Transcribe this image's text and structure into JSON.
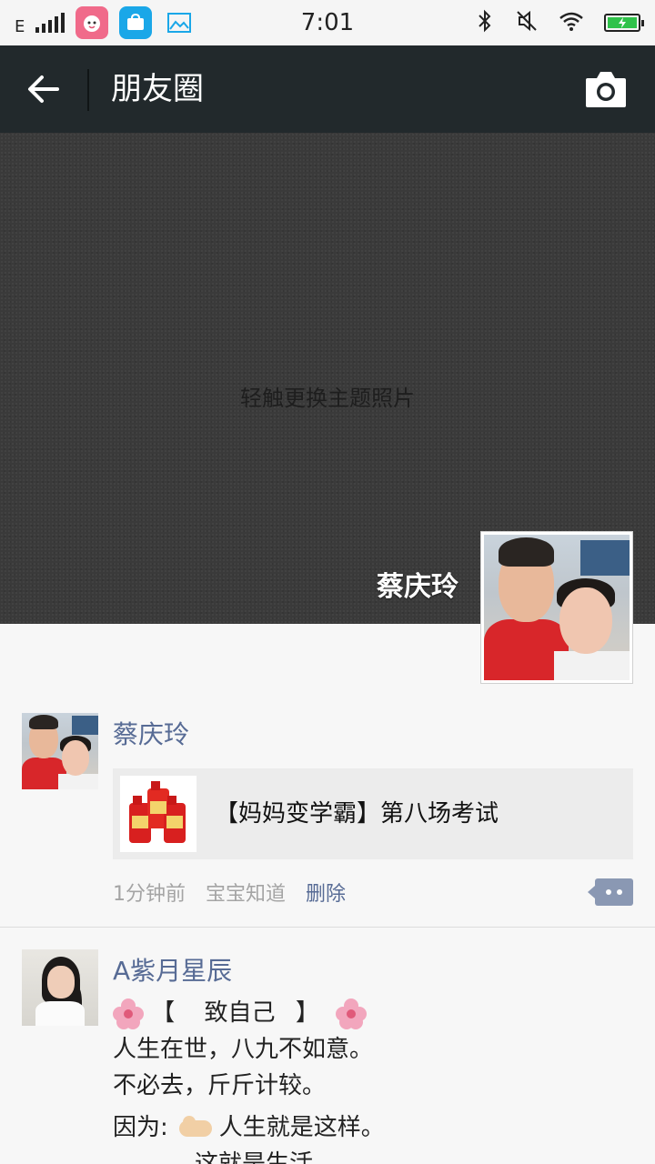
{
  "status_bar": {
    "network": "E",
    "time": "7:01",
    "battery_level": 1.0,
    "colors": {
      "battery": "#2fc24a",
      "baby_app": "#f06a8a",
      "store_app": "#1aa7e8"
    }
  },
  "title_bar": {
    "title": "朋友圈",
    "background": "#22292c"
  },
  "cover": {
    "hint": "轻触更换主题照片",
    "owner_name": "蔡庆玲"
  },
  "feed": {
    "link_color": "#576b95",
    "posts": [
      {
        "author": "蔡庆玲",
        "share": {
          "title": "【妈妈变学霸】第八场考试"
        },
        "meta": {
          "time": "1分钟前",
          "source": "宝宝知道",
          "delete": "删除"
        }
      },
      {
        "author": "A紫月星辰",
        "lines": [
          {
            "before": "【",
            "middle": "致自己",
            "after": "】"
          },
          "人生在世，八九不如意。",
          "不必去，斤斤计较。",
          {
            "prefix": "因为:",
            "text": "人生就是这样。"
          },
          "这就是生活。"
        ]
      }
    ]
  }
}
